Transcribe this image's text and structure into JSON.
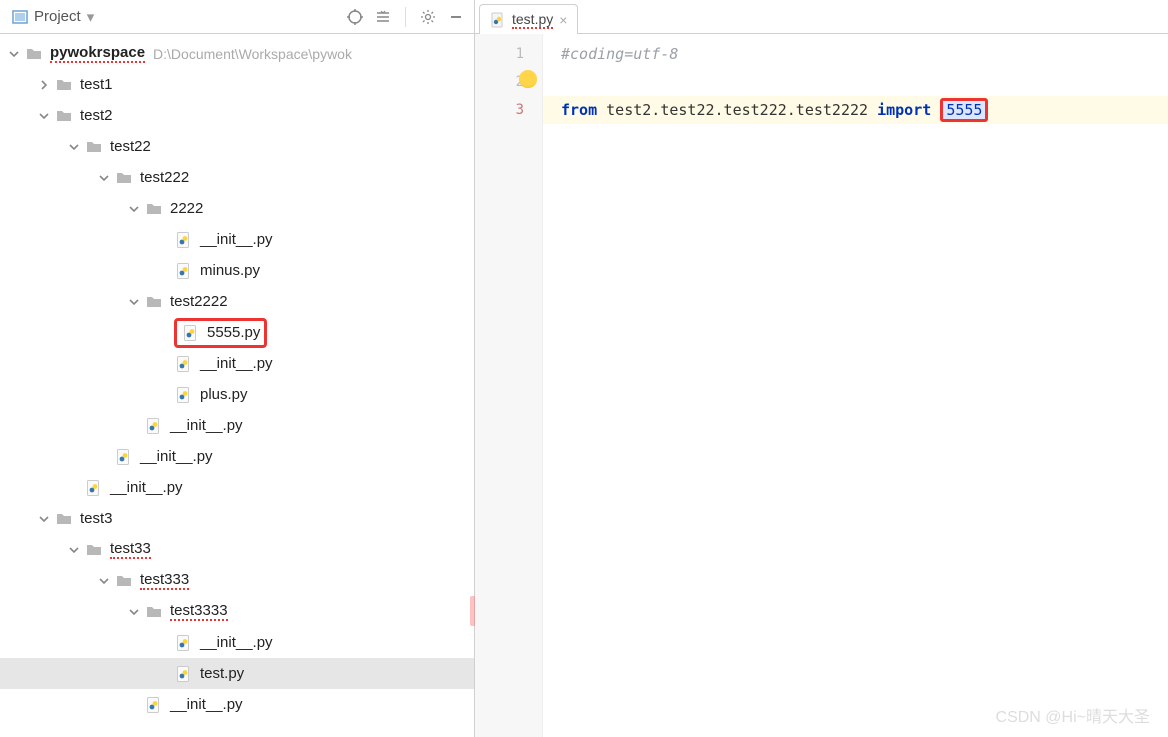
{
  "sidebar": {
    "title": "Project",
    "toolbar": {
      "locate": "locate-icon",
      "collapse": "collapse-all-icon",
      "settings": "gear-icon",
      "hide": "minimize-icon"
    }
  },
  "tree": [
    {
      "depth": 0,
      "chev": "down",
      "icon": "dir",
      "label": "pywokrspace",
      "bold": true,
      "wavy": true,
      "hint": "D:\\Document\\Workspace\\pywok"
    },
    {
      "depth": 1,
      "chev": "right",
      "icon": "dir",
      "label": "test1"
    },
    {
      "depth": 1,
      "chev": "down",
      "icon": "dir",
      "label": "test2"
    },
    {
      "depth": 2,
      "chev": "down",
      "icon": "dir",
      "label": "test22"
    },
    {
      "depth": 3,
      "chev": "down",
      "icon": "dir",
      "label": "test222"
    },
    {
      "depth": 4,
      "chev": "down",
      "icon": "dir",
      "label": "2222"
    },
    {
      "depth": 5,
      "chev": "",
      "icon": "py",
      "label": "__init__.py"
    },
    {
      "depth": 5,
      "chev": "",
      "icon": "py",
      "label": "minus.py"
    },
    {
      "depth": 4,
      "chev": "down",
      "icon": "dir",
      "label": "test2222"
    },
    {
      "depth": 5,
      "chev": "",
      "icon": "py",
      "label": "5555.py",
      "boxed": true
    },
    {
      "depth": 5,
      "chev": "",
      "icon": "py",
      "label": "__init__.py"
    },
    {
      "depth": 5,
      "chev": "",
      "icon": "py",
      "label": "plus.py"
    },
    {
      "depth": 4,
      "chev": "",
      "icon": "py",
      "label": "__init__.py"
    },
    {
      "depth": 3,
      "chev": "",
      "icon": "py",
      "label": "__init__.py"
    },
    {
      "depth": 2,
      "chev": "",
      "icon": "py",
      "label": "__init__.py"
    },
    {
      "depth": 1,
      "chev": "down",
      "icon": "dir",
      "label": "test3"
    },
    {
      "depth": 2,
      "chev": "down",
      "icon": "dir",
      "label": "test33",
      "wavy": true
    },
    {
      "depth": 3,
      "chev": "down",
      "icon": "dir",
      "label": "test333",
      "wavy": true
    },
    {
      "depth": 4,
      "chev": "down",
      "icon": "dir",
      "label": "test3333",
      "wavy": true
    },
    {
      "depth": 5,
      "chev": "",
      "icon": "py",
      "label": "__init__.py"
    },
    {
      "depth": 5,
      "chev": "",
      "icon": "py",
      "label": "test.py",
      "selected": true
    },
    {
      "depth": 4,
      "chev": "",
      "icon": "py",
      "label": "__init__.py"
    }
  ],
  "editor": {
    "tab": {
      "label": "test.py",
      "wavy": true
    },
    "lines": [
      {
        "n": 1,
        "type": "comment",
        "text": "#coding=utf-8"
      },
      {
        "n": 2,
        "type": "blank",
        "text": ""
      },
      {
        "n": 3,
        "type": "import",
        "kw1": "from",
        "mod": " test2.test22.test222.test2222 ",
        "kw2": "import",
        "target": "5555",
        "active": true
      }
    ]
  },
  "watermark": "CSDN @Hi~晴天大圣"
}
